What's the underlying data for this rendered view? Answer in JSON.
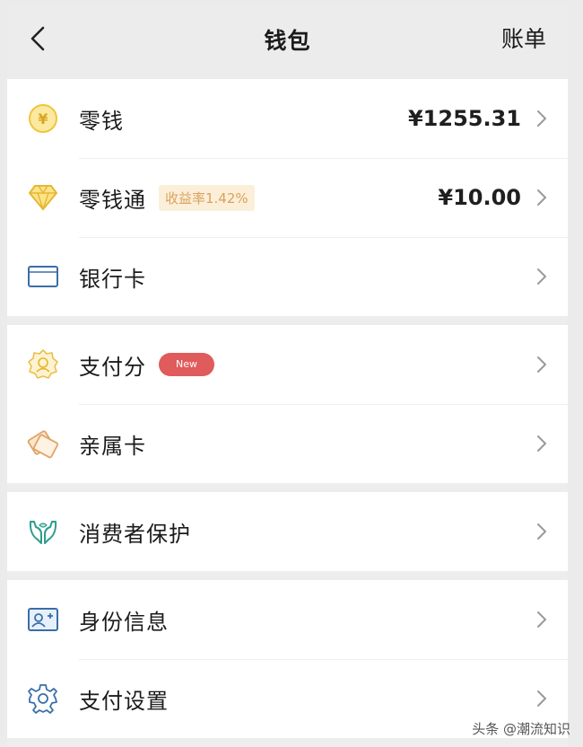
{
  "navbar": {
    "title": "钱包",
    "bill_label": "账单"
  },
  "groups": {
    "balance": {
      "change": {
        "label": "零钱",
        "value": "¥1255.31",
        "icon": "yuan-coin-icon"
      },
      "change_plus": {
        "label": "零钱通",
        "badge": "收益率1.42%",
        "value": "¥10.00",
        "icon": "diamond-icon"
      },
      "bank_card": {
        "label": "银行卡",
        "icon": "bank-card-icon"
      }
    },
    "credit": {
      "pay_score": {
        "label": "支付分",
        "badge": "New",
        "icon": "badge-icon"
      },
      "family_card": {
        "label": "亲属卡",
        "icon": "family-card-icon"
      }
    },
    "protection": {
      "consumer_protection": {
        "label": "消费者保护",
        "icon": "hands-icon"
      }
    },
    "settings": {
      "identity": {
        "label": "身份信息",
        "icon": "id-card-icon"
      },
      "pay_settings": {
        "label": "支付设置",
        "icon": "gear-icon"
      }
    }
  },
  "watermark": "头条 @潮流知识",
  "colors": {
    "background": "#ededed",
    "gold": "#f0c53c",
    "blue": "#3a6ea8",
    "green": "#2e9e8f",
    "badge_red": "#e05b5b",
    "badge_orange_bg": "#fcefd9",
    "badge_orange_text": "#d9a25d"
  }
}
